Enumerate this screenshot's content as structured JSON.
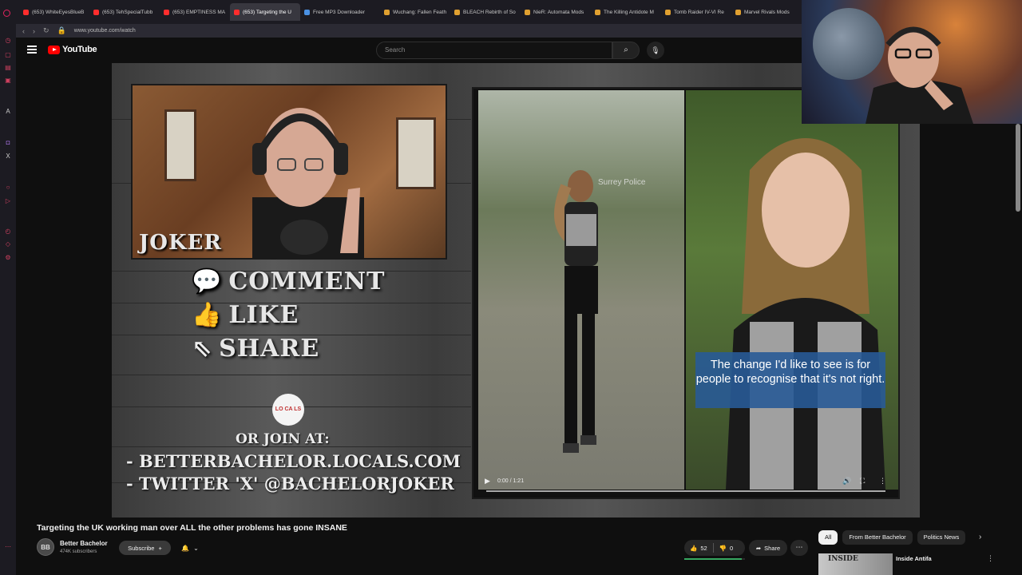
{
  "browser": {
    "tabs": [
      {
        "label": "(653) WhiteEyesBlueB",
        "color": "#ff2d2d"
      },
      {
        "label": "(653) TehSpecialTubb",
        "color": "#ff2d2d"
      },
      {
        "label": "(653) EMPTINESS MA",
        "color": "#ff2d2d"
      },
      {
        "label": "(653) Targeting the U",
        "color": "#ff2d2d",
        "active": true
      },
      {
        "label": "Free MP3 Downloader",
        "color": "#4a90e2"
      },
      {
        "label": "Wuchang: Fallen Feath",
        "color": "#e0a030"
      },
      {
        "label": "BLEACH Rebirth of So",
        "color": "#e0a030"
      },
      {
        "label": "NieR: Automata Mods",
        "color": "#e0a030"
      },
      {
        "label": "The Killing Antidote M",
        "color": "#e0a030"
      },
      {
        "label": "Tomb Raider IV-VI Re",
        "color": "#e0a030"
      },
      {
        "label": "Marvel Rivals Mods",
        "color": "#e0a030"
      }
    ],
    "url": "www.youtube.com/watch"
  },
  "header": {
    "logo_text": "YouTube",
    "search_placeholder": "Search"
  },
  "video_overlay": {
    "host_label": "JOKER",
    "comment": "COMMENT",
    "like": "LIKE",
    "share": "SHARE",
    "locals_logo": "LO CA LS",
    "join": "OR JOIN AT:",
    "link1": "- BETTERBACHELOR.LOCALS.COM",
    "link2": "- TWITTER 'X' @BACHELORJOKER"
  },
  "clip": {
    "watermark": "Surrey Police",
    "caption": "The change I'd like to see is for people to recognise that it's not right.",
    "time": "0:00 / 1:21"
  },
  "video_info": {
    "title": "Targeting the UK working man over ALL the other problems has gone INSANE",
    "channel": "Better Bachelor",
    "subscribers": "474K subscribers",
    "subscribe_label": "Subscribe",
    "likes": "52",
    "dislikes": "0",
    "share_label": "Share"
  },
  "sidebar_chips": [
    {
      "label": "All",
      "active": true
    },
    {
      "label": "From Better Bachelor"
    },
    {
      "label": "Politics News"
    }
  ],
  "recommended": {
    "thumb_text": "INSIDE",
    "title": "Inside Antifa"
  },
  "colors": {
    "accent": "#ff0000",
    "like_bar": "#37a860",
    "caption_bg": "#285a96"
  }
}
